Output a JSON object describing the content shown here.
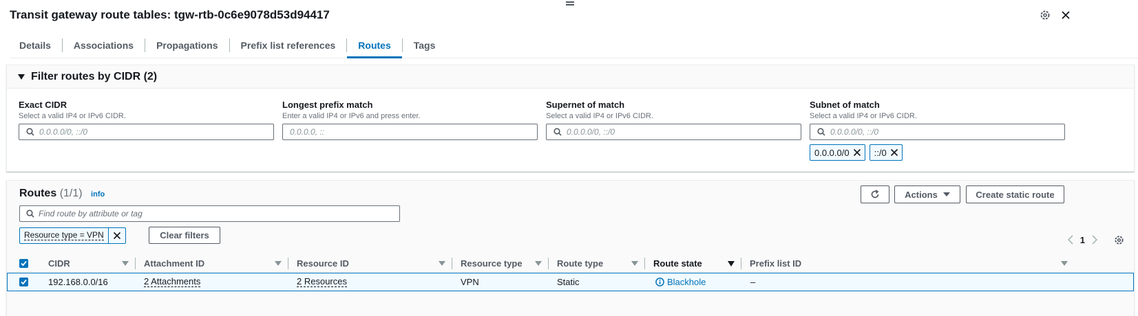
{
  "header": {
    "title": "Transit gateway route tables: tgw-rtb-0c6e9078d53d94417"
  },
  "tabs": [
    {
      "label": "Details"
    },
    {
      "label": "Associations"
    },
    {
      "label": "Propagations"
    },
    {
      "label": "Prefix list references"
    },
    {
      "label": "Routes",
      "active": true
    },
    {
      "label": "Tags"
    }
  ],
  "filter": {
    "title": "Filter routes by CIDR (2)",
    "fields": [
      {
        "label": "Exact CIDR",
        "description": "Select a valid IP4 or IPv6 CIDR.",
        "placeholder": "0.0.0.0/0, ::/0"
      },
      {
        "label": "Longest prefix match",
        "description": "Enter a valid IP4 or IPv6 and press enter.",
        "placeholder": "0.0.0.0, ::"
      },
      {
        "label": "Supernet of match",
        "description": "Select a valid IP4 or IPv6 CIDR.",
        "placeholder": "0.0.0.0/0, ::/0"
      },
      {
        "label": "Subnet of match",
        "description": "Select a valid IP4 or IPv6 CIDR.",
        "placeholder": "0.0.0.0/0, ::/0"
      }
    ],
    "tokens": [
      "0.0.0.0/0",
      "::/0"
    ]
  },
  "routes": {
    "title": "Routes",
    "count": "(1/1)",
    "info": "info",
    "actions_label": "Actions",
    "create_label": "Create static route",
    "search_placeholder": "Find route by attribute or tag",
    "active_filter": "Resource type = VPN",
    "clear_filters": "Clear filters",
    "page": "1",
    "columns": [
      "CIDR",
      "Attachment ID",
      "Resource ID",
      "Resource type",
      "Route type",
      "Route state",
      "Prefix list ID"
    ],
    "rows": [
      {
        "cidr": "192.168.0.0/16",
        "attachment": "2 Attachments",
        "resource": "2 Resources",
        "resource_type": "VPN",
        "route_type": "Static",
        "route_state": "Blackhole",
        "prefix_list": "–"
      }
    ]
  },
  "colors": {
    "accent": "#0073bb",
    "text": "#16191f",
    "muted": "#545b64"
  }
}
